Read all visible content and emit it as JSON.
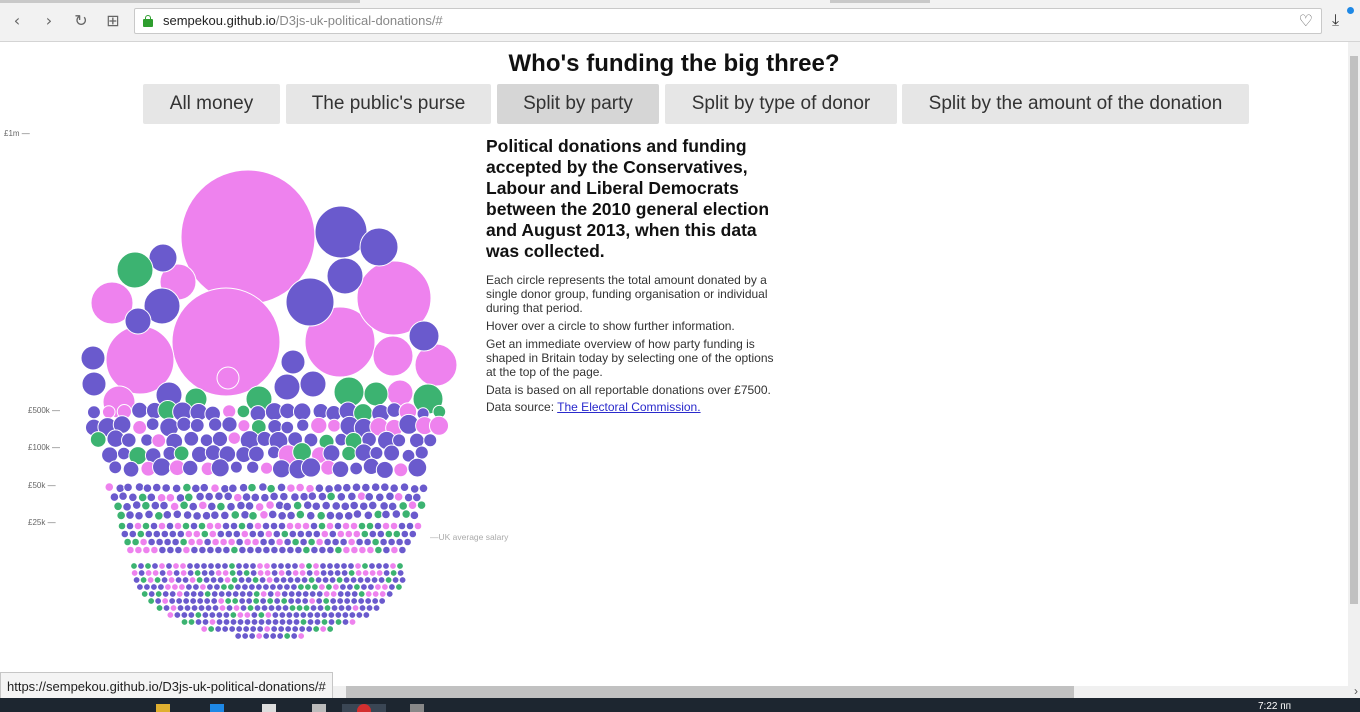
{
  "browser": {
    "url_domain": "sempekou.github.io",
    "url_path": "/D3js-uk-political-donations/#",
    "status_url": "https://sempekou.github.io/D3js-uk-political-donations/#",
    "clock": "7:22 пп"
  },
  "page": {
    "title": "Who's funding the big three?",
    "nav": [
      "All money",
      "The public's purse",
      "Split by party",
      "Split by type of donor",
      "Split by the amount of the donation"
    ],
    "active_nav": "Split by party",
    "info_title": "Political donations and funding accepted by the Conservatives, Labour and Liberal Democrats between the 2010 general election and August 2013, when this data was collected.",
    "info_p1": "Each circle represents the total amount donated by a single donor group, funding organisation or individual during that period.",
    "info_p2": "Hover over a circle to show further information.",
    "info_p3": "Get an immediate overview of how party funding is shaped in Britain today by selecting one of the options at the top of the page.",
    "info_p4": "Data is based on all reportable donations over £7500.",
    "source_prefix": "Data source:",
    "source_link": "The Electoral Commission."
  },
  "axis": {
    "top": "£1m —",
    "l500": "£500k —",
    "l100": "£100k —",
    "l50": "£50k —",
    "l25": "£25k —",
    "avg": "—UK average salary"
  },
  "colors": {
    "purple": "#6a5acd",
    "pink": "#ee82ee",
    "green": "#3cb371"
  }
}
